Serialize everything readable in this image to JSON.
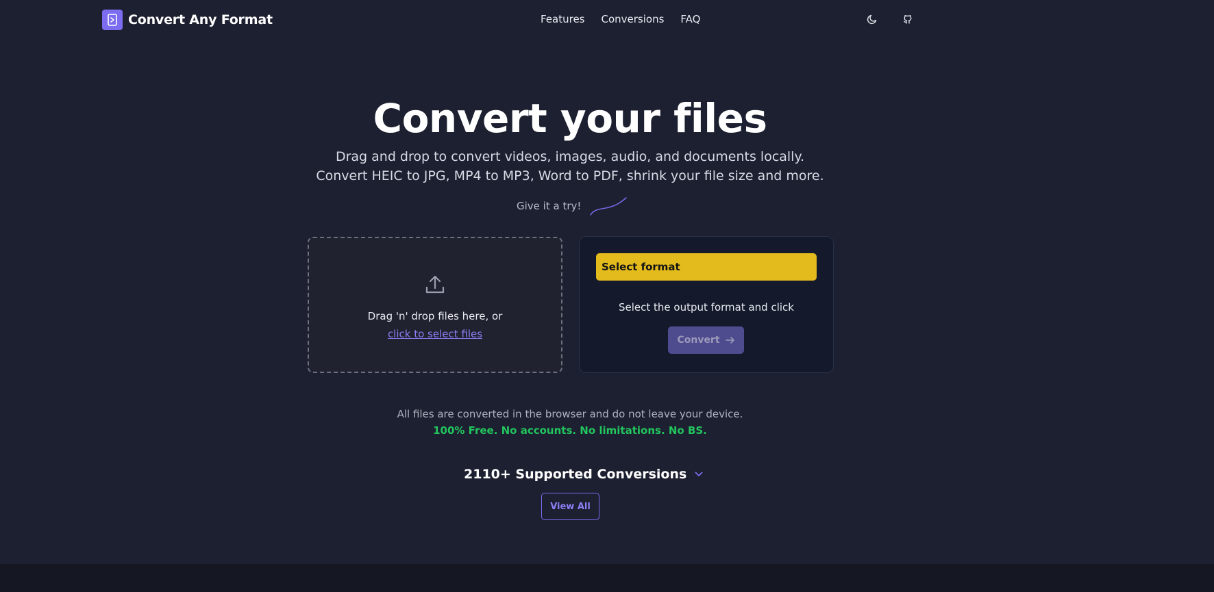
{
  "header": {
    "brand": "Convert Any Format",
    "nav": [
      "Features",
      "Conversions",
      "FAQ"
    ],
    "icons": [
      "moon-icon",
      "github-icon"
    ]
  },
  "hero": {
    "title": "Convert your files",
    "subtitle": "Drag and drop to convert videos, images, audio, and documents locally. Convert HEIC to JPG, MP4 to MP3, Word to PDF, shrink your file size and more.",
    "try_label": "Give it a try!"
  },
  "dropzone": {
    "text": "Drag 'n' drop files here, or",
    "link": "click to select files"
  },
  "format_panel": {
    "select_label": "Select format",
    "hint": "Select the output format and click",
    "convert_label": "Convert"
  },
  "info": {
    "privacy": "All files are converted in the browser and do not leave your device.",
    "free": "100% Free. No accounts. No limitations. No BS."
  },
  "conversions": {
    "label": "2110+ Supported Conversions",
    "view_all": "View All"
  },
  "colors": {
    "background": "#1c2030",
    "accent": "#7c6cf0",
    "select": "#e3bb1c",
    "success": "#22c55e"
  }
}
